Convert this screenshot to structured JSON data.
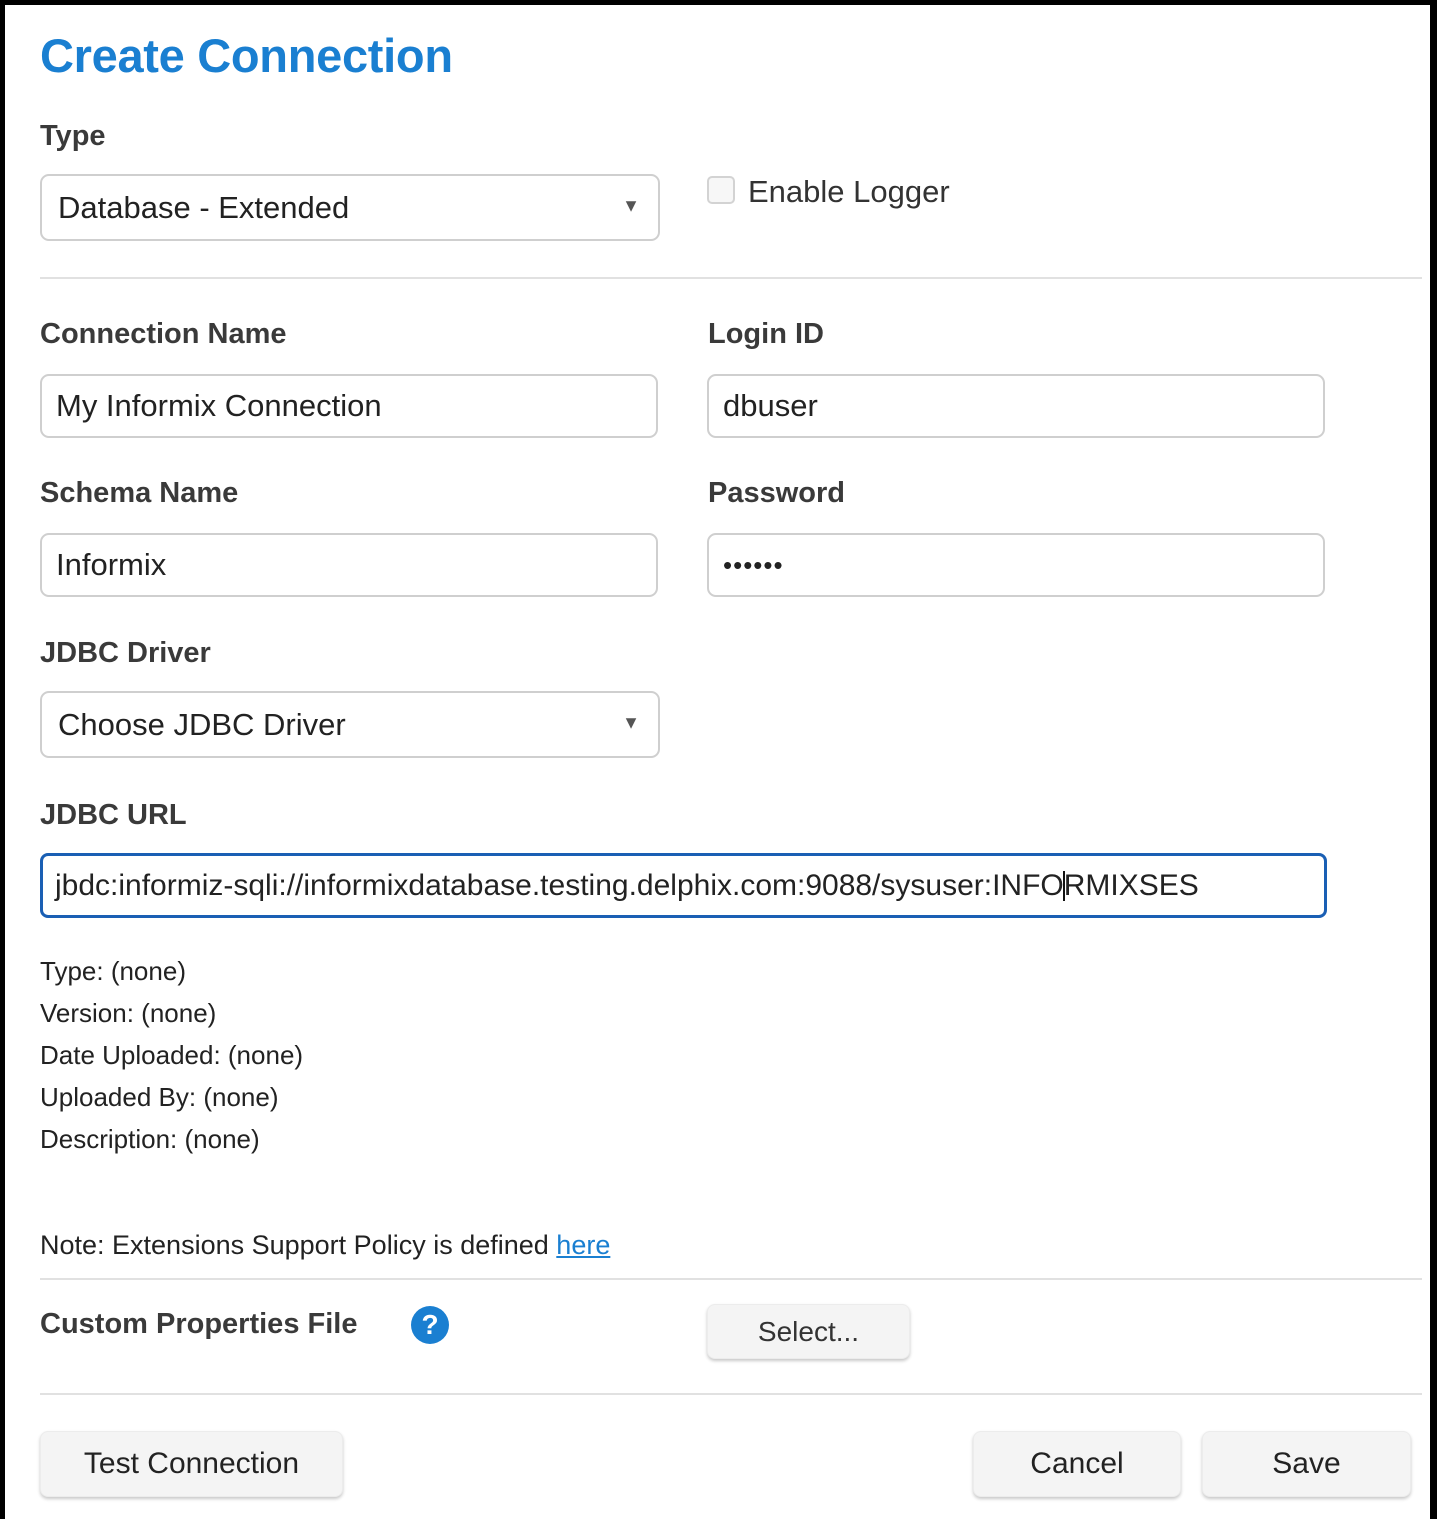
{
  "dialog": {
    "title": "Create Connection"
  },
  "type_section": {
    "label": "Type",
    "selected": "Database - Extended",
    "enable_logger_label": "Enable Logger",
    "enable_logger_checked": false
  },
  "connection_name": {
    "label": "Connection Name",
    "value": "My Informix Connection"
  },
  "login_id": {
    "label": "Login ID",
    "value": "dbuser"
  },
  "schema_name": {
    "label": "Schema Name",
    "value": "Informix"
  },
  "password": {
    "label": "Password",
    "value": "••••••"
  },
  "jdbc_driver": {
    "label": "JDBC Driver",
    "selected": "Choose JDBC Driver"
  },
  "jdbc_url": {
    "label": "JDBC URL",
    "value_before_cursor": "jbdc:informiz-sqli://informixdatabase.testing.delphix.com:9088/sysuser:INFO",
    "value_after_cursor": "RMIXSES"
  },
  "driver_info": {
    "type": "Type: (none)",
    "version": "Version: (none)",
    "date_uploaded": "Date Uploaded: (none)",
    "uploaded_by": "Uploaded By: (none)",
    "description": "Description: (none)"
  },
  "note": {
    "text": "Note: Extensions Support Policy is defined ",
    "link_text": "here"
  },
  "custom_properties": {
    "label": "Custom Properties File",
    "select_button": "Select..."
  },
  "footer": {
    "test_connection": "Test Connection",
    "cancel": "Cancel",
    "save": "Save"
  },
  "colors": {
    "accent": "#1a7fd1",
    "focus_border": "#1a5fb4"
  }
}
